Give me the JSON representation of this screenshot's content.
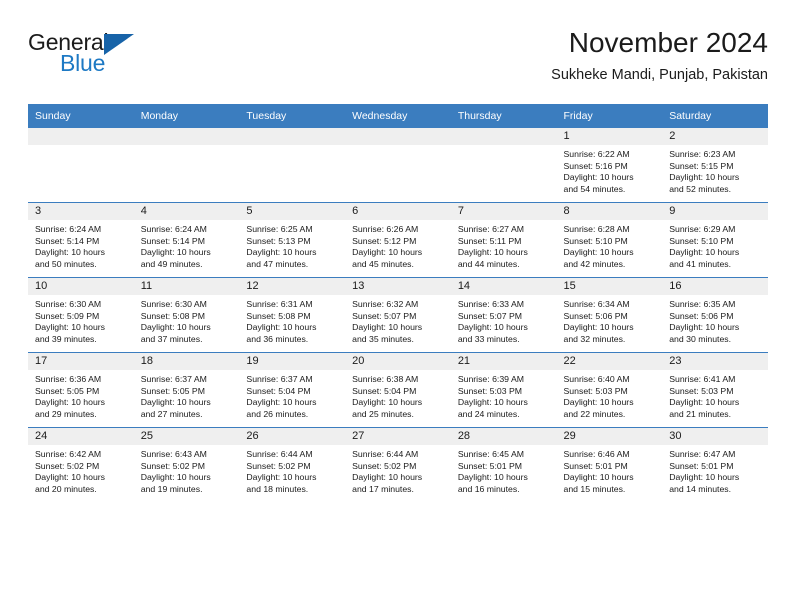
{
  "brand": {
    "line1": "General",
    "line2": "Blue",
    "triangle_color": "#1763a8",
    "blue_color": "#1d79c4"
  },
  "header": {
    "title": "November 2024",
    "subtitle": "Sukheke Mandi, Punjab, Pakistan",
    "header_bg": "#3b7dbf",
    "daynum_bg": "#efefef"
  },
  "weekday_headers": [
    "Sunday",
    "Monday",
    "Tuesday",
    "Wednesday",
    "Thursday",
    "Friday",
    "Saturday"
  ],
  "weeks": [
    [
      {
        "day": "",
        "sunrise": "",
        "sunset": "",
        "daylight1": "",
        "daylight2": "",
        "empty": true
      },
      {
        "day": "",
        "sunrise": "",
        "sunset": "",
        "daylight1": "",
        "daylight2": "",
        "empty": true
      },
      {
        "day": "",
        "sunrise": "",
        "sunset": "",
        "daylight1": "",
        "daylight2": "",
        "empty": true
      },
      {
        "day": "",
        "sunrise": "",
        "sunset": "",
        "daylight1": "",
        "daylight2": "",
        "empty": true
      },
      {
        "day": "",
        "sunrise": "",
        "sunset": "",
        "daylight1": "",
        "daylight2": "",
        "empty": true
      },
      {
        "day": "1",
        "sunrise": "Sunrise: 6:22 AM",
        "sunset": "Sunset: 5:16 PM",
        "daylight1": "Daylight: 10 hours",
        "daylight2": "and 54 minutes."
      },
      {
        "day": "2",
        "sunrise": "Sunrise: 6:23 AM",
        "sunset": "Sunset: 5:15 PM",
        "daylight1": "Daylight: 10 hours",
        "daylight2": "and 52 minutes."
      }
    ],
    [
      {
        "day": "3",
        "sunrise": "Sunrise: 6:24 AM",
        "sunset": "Sunset: 5:14 PM",
        "daylight1": "Daylight: 10 hours",
        "daylight2": "and 50 minutes."
      },
      {
        "day": "4",
        "sunrise": "Sunrise: 6:24 AM",
        "sunset": "Sunset: 5:14 PM",
        "daylight1": "Daylight: 10 hours",
        "daylight2": "and 49 minutes."
      },
      {
        "day": "5",
        "sunrise": "Sunrise: 6:25 AM",
        "sunset": "Sunset: 5:13 PM",
        "daylight1": "Daylight: 10 hours",
        "daylight2": "and 47 minutes."
      },
      {
        "day": "6",
        "sunrise": "Sunrise: 6:26 AM",
        "sunset": "Sunset: 5:12 PM",
        "daylight1": "Daylight: 10 hours",
        "daylight2": "and 45 minutes."
      },
      {
        "day": "7",
        "sunrise": "Sunrise: 6:27 AM",
        "sunset": "Sunset: 5:11 PM",
        "daylight1": "Daylight: 10 hours",
        "daylight2": "and 44 minutes."
      },
      {
        "day": "8",
        "sunrise": "Sunrise: 6:28 AM",
        "sunset": "Sunset: 5:10 PM",
        "daylight1": "Daylight: 10 hours",
        "daylight2": "and 42 minutes."
      },
      {
        "day": "9",
        "sunrise": "Sunrise: 6:29 AM",
        "sunset": "Sunset: 5:10 PM",
        "daylight1": "Daylight: 10 hours",
        "daylight2": "and 41 minutes."
      }
    ],
    [
      {
        "day": "10",
        "sunrise": "Sunrise: 6:30 AM",
        "sunset": "Sunset: 5:09 PM",
        "daylight1": "Daylight: 10 hours",
        "daylight2": "and 39 minutes."
      },
      {
        "day": "11",
        "sunrise": "Sunrise: 6:30 AM",
        "sunset": "Sunset: 5:08 PM",
        "daylight1": "Daylight: 10 hours",
        "daylight2": "and 37 minutes."
      },
      {
        "day": "12",
        "sunrise": "Sunrise: 6:31 AM",
        "sunset": "Sunset: 5:08 PM",
        "daylight1": "Daylight: 10 hours",
        "daylight2": "and 36 minutes."
      },
      {
        "day": "13",
        "sunrise": "Sunrise: 6:32 AM",
        "sunset": "Sunset: 5:07 PM",
        "daylight1": "Daylight: 10 hours",
        "daylight2": "and 35 minutes."
      },
      {
        "day": "14",
        "sunrise": "Sunrise: 6:33 AM",
        "sunset": "Sunset: 5:07 PM",
        "daylight1": "Daylight: 10 hours",
        "daylight2": "and 33 minutes."
      },
      {
        "day": "15",
        "sunrise": "Sunrise: 6:34 AM",
        "sunset": "Sunset: 5:06 PM",
        "daylight1": "Daylight: 10 hours",
        "daylight2": "and 32 minutes."
      },
      {
        "day": "16",
        "sunrise": "Sunrise: 6:35 AM",
        "sunset": "Sunset: 5:06 PM",
        "daylight1": "Daylight: 10 hours",
        "daylight2": "and 30 minutes."
      }
    ],
    [
      {
        "day": "17",
        "sunrise": "Sunrise: 6:36 AM",
        "sunset": "Sunset: 5:05 PM",
        "daylight1": "Daylight: 10 hours",
        "daylight2": "and 29 minutes."
      },
      {
        "day": "18",
        "sunrise": "Sunrise: 6:37 AM",
        "sunset": "Sunset: 5:05 PM",
        "daylight1": "Daylight: 10 hours",
        "daylight2": "and 27 minutes."
      },
      {
        "day": "19",
        "sunrise": "Sunrise: 6:37 AM",
        "sunset": "Sunset: 5:04 PM",
        "daylight1": "Daylight: 10 hours",
        "daylight2": "and 26 minutes."
      },
      {
        "day": "20",
        "sunrise": "Sunrise: 6:38 AM",
        "sunset": "Sunset: 5:04 PM",
        "daylight1": "Daylight: 10 hours",
        "daylight2": "and 25 minutes."
      },
      {
        "day": "21",
        "sunrise": "Sunrise: 6:39 AM",
        "sunset": "Sunset: 5:03 PM",
        "daylight1": "Daylight: 10 hours",
        "daylight2": "and 24 minutes."
      },
      {
        "day": "22",
        "sunrise": "Sunrise: 6:40 AM",
        "sunset": "Sunset: 5:03 PM",
        "daylight1": "Daylight: 10 hours",
        "daylight2": "and 22 minutes."
      },
      {
        "day": "23",
        "sunrise": "Sunrise: 6:41 AM",
        "sunset": "Sunset: 5:03 PM",
        "daylight1": "Daylight: 10 hours",
        "daylight2": "and 21 minutes."
      }
    ],
    [
      {
        "day": "24",
        "sunrise": "Sunrise: 6:42 AM",
        "sunset": "Sunset: 5:02 PM",
        "daylight1": "Daylight: 10 hours",
        "daylight2": "and 20 minutes."
      },
      {
        "day": "25",
        "sunrise": "Sunrise: 6:43 AM",
        "sunset": "Sunset: 5:02 PM",
        "daylight1": "Daylight: 10 hours",
        "daylight2": "and 19 minutes."
      },
      {
        "day": "26",
        "sunrise": "Sunrise: 6:44 AM",
        "sunset": "Sunset: 5:02 PM",
        "daylight1": "Daylight: 10 hours",
        "daylight2": "and 18 minutes."
      },
      {
        "day": "27",
        "sunrise": "Sunrise: 6:44 AM",
        "sunset": "Sunset: 5:02 PM",
        "daylight1": "Daylight: 10 hours",
        "daylight2": "and 17 minutes."
      },
      {
        "day": "28",
        "sunrise": "Sunrise: 6:45 AM",
        "sunset": "Sunset: 5:01 PM",
        "daylight1": "Daylight: 10 hours",
        "daylight2": "and 16 minutes."
      },
      {
        "day": "29",
        "sunrise": "Sunrise: 6:46 AM",
        "sunset": "Sunset: 5:01 PM",
        "daylight1": "Daylight: 10 hours",
        "daylight2": "and 15 minutes."
      },
      {
        "day": "30",
        "sunrise": "Sunrise: 6:47 AM",
        "sunset": "Sunset: 5:01 PM",
        "daylight1": "Daylight: 10 hours",
        "daylight2": "and 14 minutes."
      }
    ]
  ]
}
